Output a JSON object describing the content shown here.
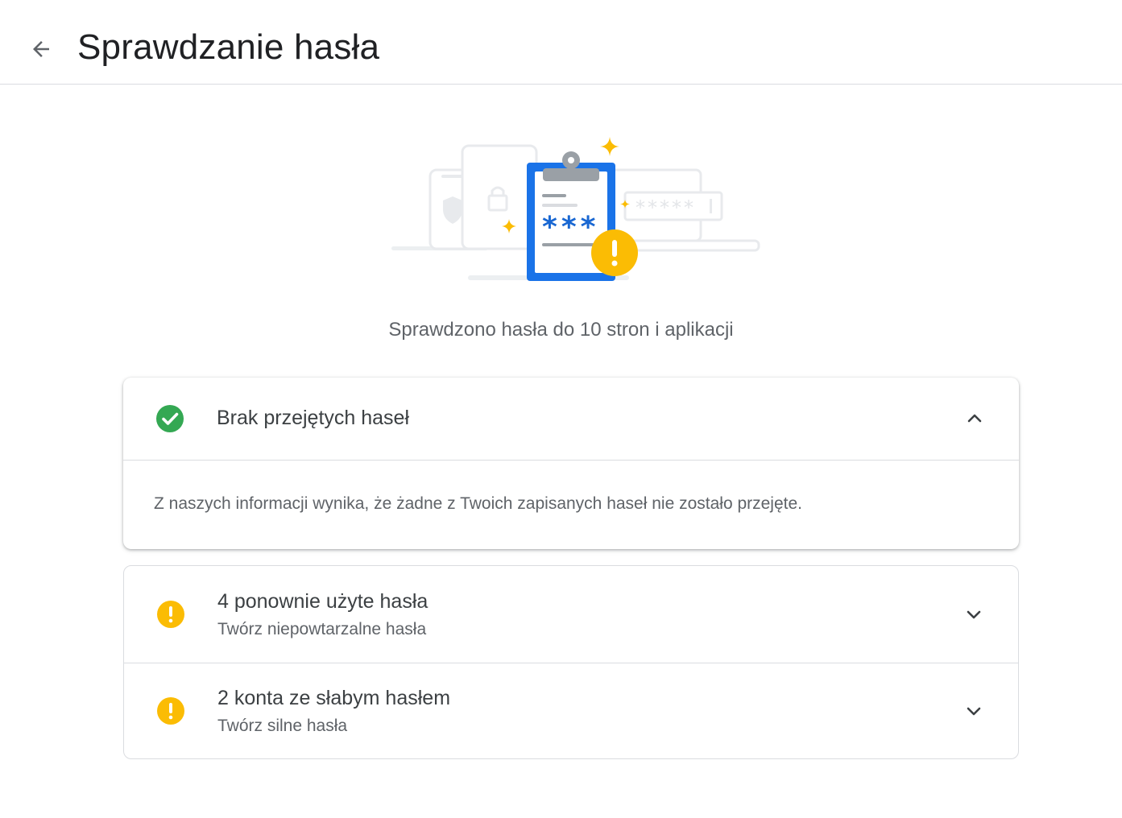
{
  "header": {
    "title": "Sprawdzanie hasła",
    "back_icon": "arrow-back-icon"
  },
  "illustration": {
    "password_mask": "*****",
    "clipboard_mask": "***"
  },
  "summary": "Sprawdzono hasła do 10 stron i aplikacji",
  "sections": [
    {
      "title": "Brak przejętych haseł",
      "status": "ok",
      "icon": "check-circle-icon",
      "icon_color": "#34a853",
      "expanded": true,
      "detail": "Z naszych informacji wynika, że żadne z Twoich zapisanych haseł nie zostało przejęte."
    },
    {
      "title": "4 ponownie użyte hasła",
      "subtitle": "Twórz niepowtarzalne hasła",
      "status": "warning",
      "icon": "warning-circle-icon",
      "icon_color": "#fbbc04",
      "expanded": false
    },
    {
      "title": "2 konta ze słabym hasłem",
      "subtitle": "Twórz silne hasła",
      "status": "warning",
      "icon": "warning-circle-icon",
      "icon_color": "#fbbc04",
      "expanded": false
    }
  ],
  "colors": {
    "accent_blue": "#1a73e8",
    "ok_green": "#34a853",
    "warning_yellow": "#fbbc04",
    "text_primary": "#202124",
    "text_secondary": "#5f6368",
    "divider": "#dadce0"
  }
}
